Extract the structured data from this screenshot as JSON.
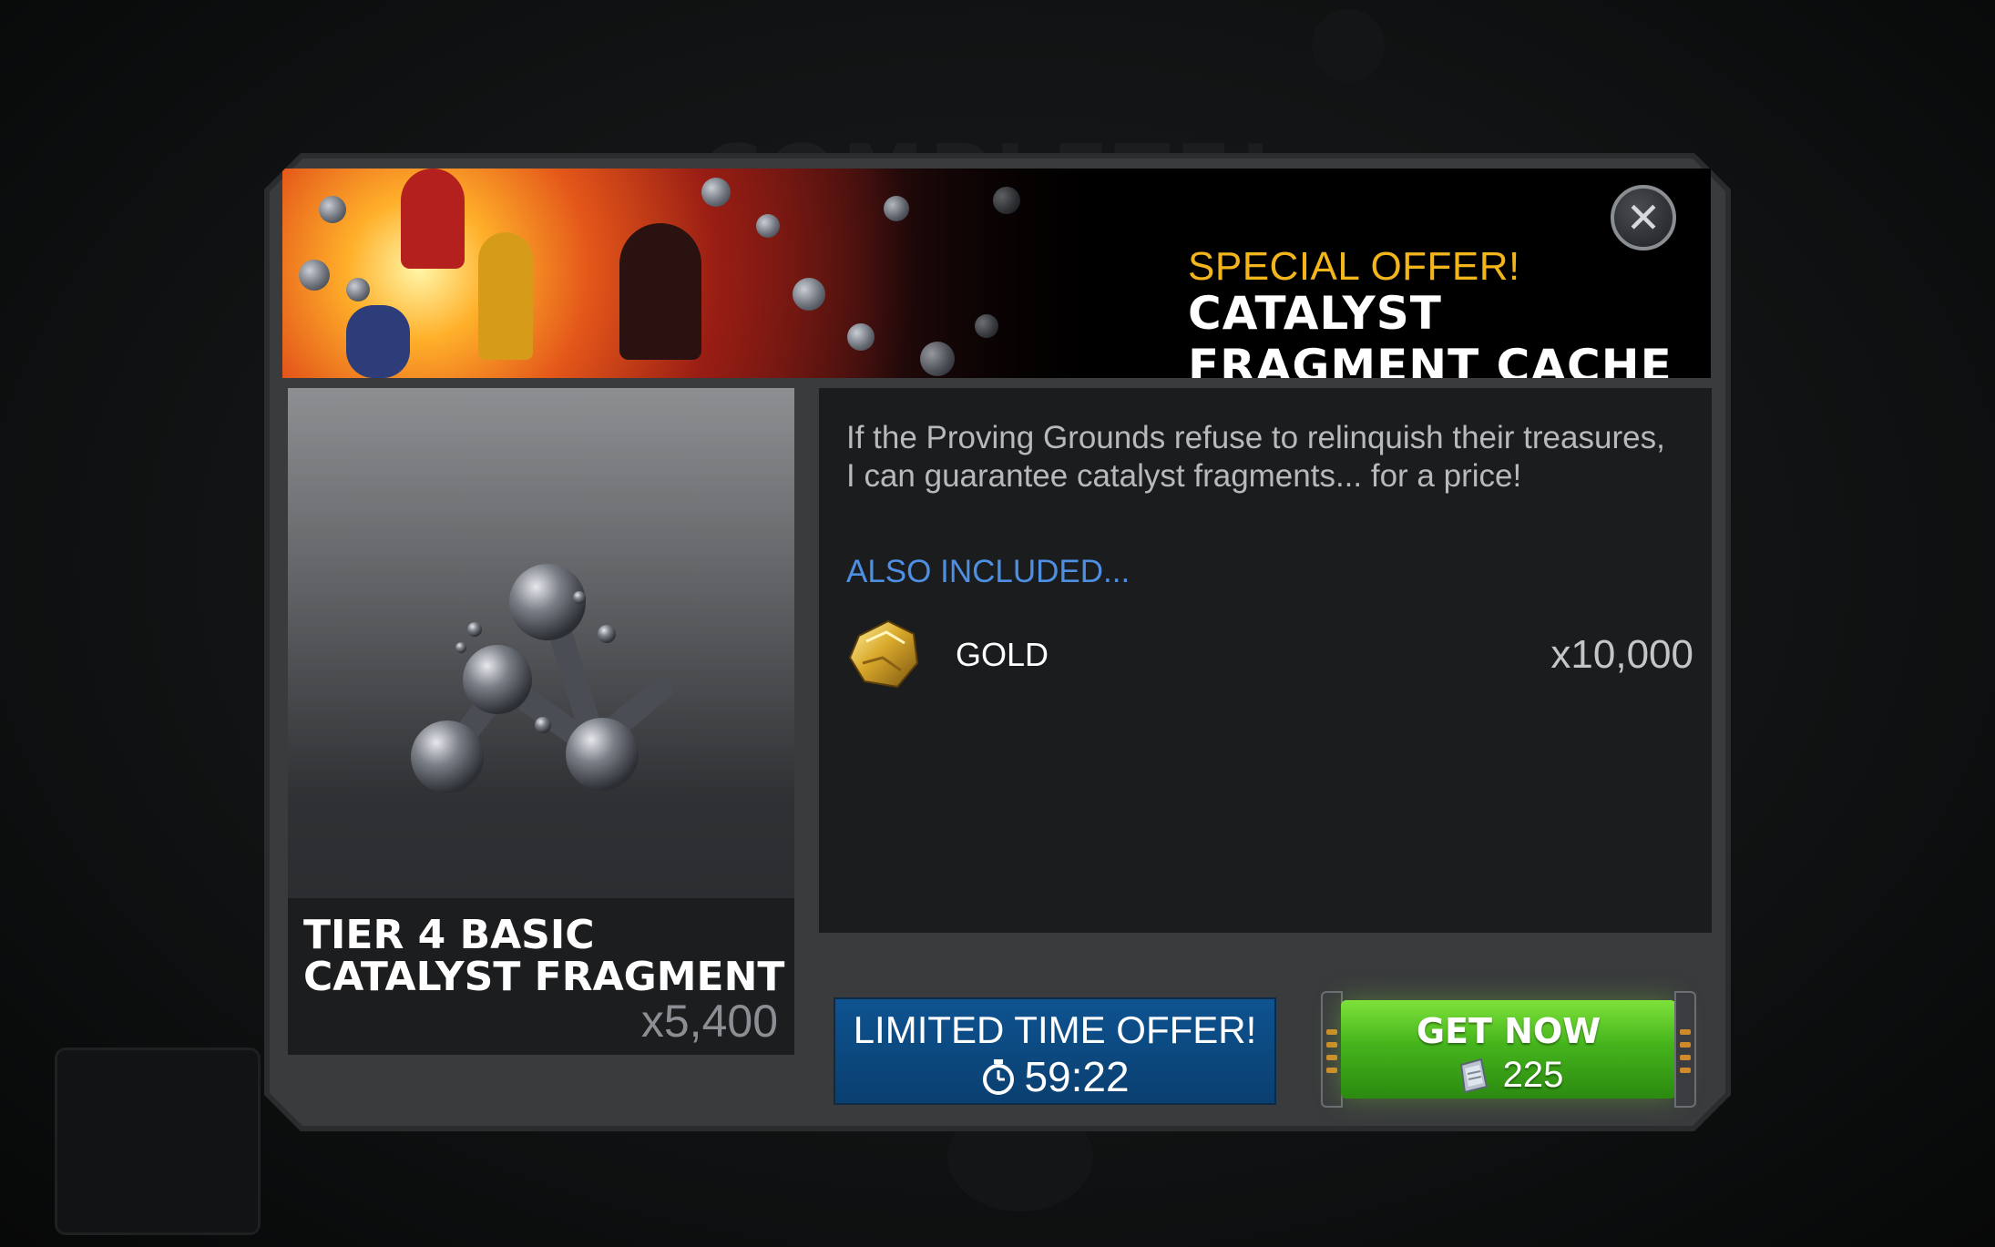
{
  "background": {
    "ghost_text": "COMPLETE!"
  },
  "banner": {
    "kicker": "SPECIAL OFFER!",
    "title": "CATALYST FRAGMENT CACHE",
    "close_icon": "close-icon"
  },
  "item": {
    "name_line1": "TIER 4 BASIC",
    "name_line2": "CATALYST FRAGMENT",
    "quantity": "x5,400",
    "icon": "catalyst-fragment-icon"
  },
  "description": {
    "text": "If the Proving Grounds refuse to relinquish their treasures, I can guarantee catalyst fragments... for a price!",
    "also_included": "ALSO INCLUDED...",
    "rewards": [
      {
        "name": "GOLD",
        "quantity": "x10,000",
        "icon": "gold-icon"
      }
    ]
  },
  "limited": {
    "title": "LIMITED TIME OFFER!",
    "timer": "59:22",
    "timer_icon": "stopwatch-icon"
  },
  "purchase": {
    "label": "GET NOW",
    "price": "225",
    "currency_icon": "units-icon"
  },
  "colors": {
    "kicker": "#f2b51b",
    "also_included": "#4f8fe3",
    "get_now_green": "#45b41c",
    "limited_blue": "#0e5390"
  }
}
